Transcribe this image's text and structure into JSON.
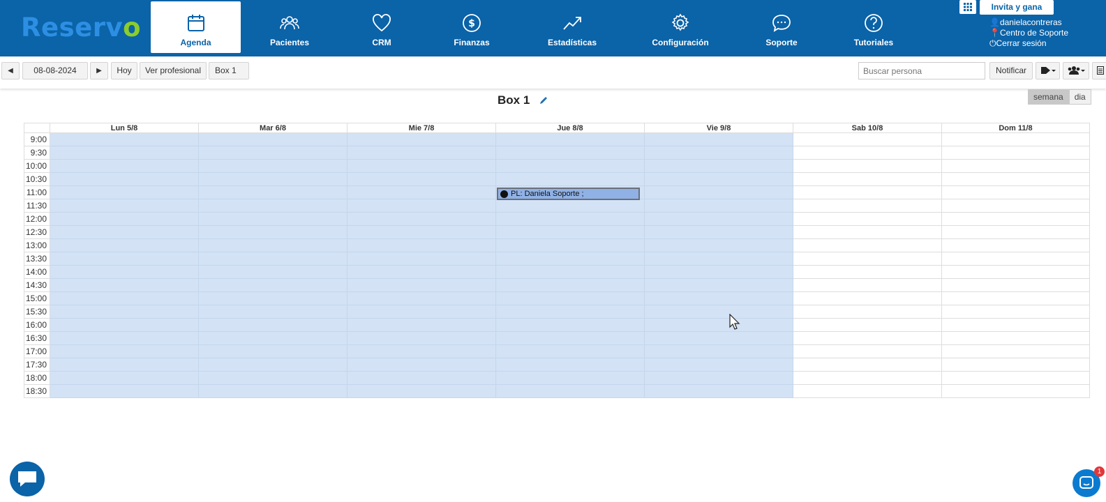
{
  "brand": {
    "logo_text": "Reserv",
    "logo_check": "o"
  },
  "nav": [
    {
      "label": "Agenda",
      "icon": "calendar-icon",
      "active": true
    },
    {
      "label": "Pacientes",
      "icon": "users-icon"
    },
    {
      "label": "CRM",
      "icon": "heart-icon"
    },
    {
      "label": "Finanzas",
      "icon": "dollar-icon"
    },
    {
      "label": "Estadísticas",
      "icon": "trend-icon"
    },
    {
      "label": "Configuración",
      "icon": "gear-icon"
    },
    {
      "label": "Soporte",
      "icon": "chat-bubble-icon"
    },
    {
      "label": "Tutoriales",
      "icon": "help-icon"
    }
  ],
  "header_right": {
    "invite_label": "Invita y gana",
    "username": "danielacontreras",
    "support_center": "Centro de Soporte",
    "logout": "Cerrar sesión"
  },
  "toolbar": {
    "prev": "◀",
    "date": "08-08-2024",
    "next": "▶",
    "today": "Hoy",
    "view_professional": "Ver profesional",
    "box": "Box 1",
    "search_placeholder": "Buscar persona",
    "notify": "Notificar"
  },
  "calendar": {
    "title": "Box 1",
    "view_week": "semana",
    "view_day": "dia",
    "days": [
      "Lun 5/8",
      "Mar 6/8",
      "Mie 7/8",
      "Jue 8/8",
      "Vie 9/8",
      "Sab 10/8",
      "Dom 11/8"
    ],
    "times": [
      "9:00",
      "9:30",
      "10:00",
      "10:30",
      "11:00",
      "11:30",
      "12:00",
      "12:30",
      "13:00",
      "13:30",
      "14:00",
      "14:30",
      "15:00",
      "15:30",
      "16:00",
      "16:30",
      "17:00",
      "17:30",
      "18:00",
      "18:30"
    ],
    "event": {
      "text": "PL: Daniela Soporte ;",
      "day": "Jue 8/8",
      "time": "11:00"
    }
  },
  "support_badge": "1",
  "colors": {
    "nav_bg": "#0b63a8",
    "workday_bg": "#d3e2f5",
    "event_bg": "#8fb1e6"
  }
}
